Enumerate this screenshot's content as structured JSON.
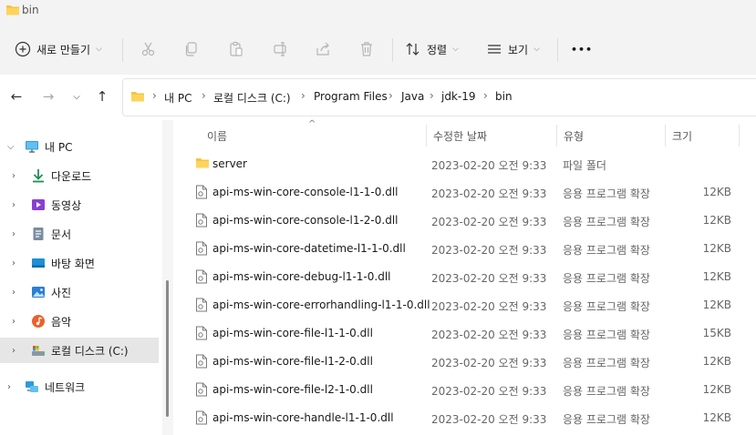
{
  "window": {
    "title": "bin"
  },
  "toolbar": {
    "new_label": "새로 만들기",
    "sort_label": "정렬",
    "view_label": "보기",
    "more_label": "•••"
  },
  "address": {
    "crumbs": [
      "내 PC",
      "로컬 디스크 (C:)",
      "Program Files",
      "Java",
      "jdk-19",
      "bin"
    ]
  },
  "sidebar": {
    "items": [
      {
        "label": "내 PC",
        "icon": "monitor-icon"
      },
      {
        "label": "다운로드",
        "icon": "download-icon"
      },
      {
        "label": "동영상",
        "icon": "video-icon"
      },
      {
        "label": "문서",
        "icon": "document-icon"
      },
      {
        "label": "바탕 화면",
        "icon": "desktop-icon"
      },
      {
        "label": "사진",
        "icon": "picture-icon"
      },
      {
        "label": "음악",
        "icon": "music-icon"
      },
      {
        "label": "로컬 디스크 (C:)",
        "icon": "drive-icon"
      },
      {
        "label": "네트워크",
        "icon": "network-icon"
      }
    ]
  },
  "columns": {
    "name": "이름",
    "date": "수정한 날짜",
    "type": "유형",
    "size": "크기"
  },
  "files": [
    {
      "name": "server",
      "date": "2023-02-20 오전 9:33",
      "type": "파일 폴더",
      "size": "",
      "kind": "folder"
    },
    {
      "name": "api-ms-win-core-console-l1-1-0.dll",
      "date": "2023-02-20 오전 9:33",
      "type": "응용 프로그램 확장",
      "size": "12KB",
      "kind": "dll"
    },
    {
      "name": "api-ms-win-core-console-l1-2-0.dll",
      "date": "2023-02-20 오전 9:33",
      "type": "응용 프로그램 확장",
      "size": "12KB",
      "kind": "dll"
    },
    {
      "name": "api-ms-win-core-datetime-l1-1-0.dll",
      "date": "2023-02-20 오전 9:33",
      "type": "응용 프로그램 확장",
      "size": "12KB",
      "kind": "dll"
    },
    {
      "name": "api-ms-win-core-debug-l1-1-0.dll",
      "date": "2023-02-20 오전 9:33",
      "type": "응용 프로그램 확장",
      "size": "12KB",
      "kind": "dll"
    },
    {
      "name": "api-ms-win-core-errorhandling-l1-1-0.dll",
      "date": "2023-02-20 오전 9:33",
      "type": "응용 프로그램 확장",
      "size": "12KB",
      "kind": "dll"
    },
    {
      "name": "api-ms-win-core-file-l1-1-0.dll",
      "date": "2023-02-20 오전 9:33",
      "type": "응용 프로그램 확장",
      "size": "15KB",
      "kind": "dll"
    },
    {
      "name": "api-ms-win-core-file-l1-2-0.dll",
      "date": "2023-02-20 오전 9:33",
      "type": "응용 프로그램 확장",
      "size": "12KB",
      "kind": "dll"
    },
    {
      "name": "api-ms-win-core-file-l2-1-0.dll",
      "date": "2023-02-20 오전 9:33",
      "type": "응용 프로그램 확장",
      "size": "12KB",
      "kind": "dll"
    },
    {
      "name": "api-ms-win-core-handle-l1-1-0.dll",
      "date": "2023-02-20 오전 9:33",
      "type": "응용 프로그램 확장",
      "size": "12KB",
      "kind": "dll"
    }
  ],
  "colors": {
    "folder": "#f4c542",
    "accent": "#0067c0",
    "selected": "#e6e6e6"
  }
}
